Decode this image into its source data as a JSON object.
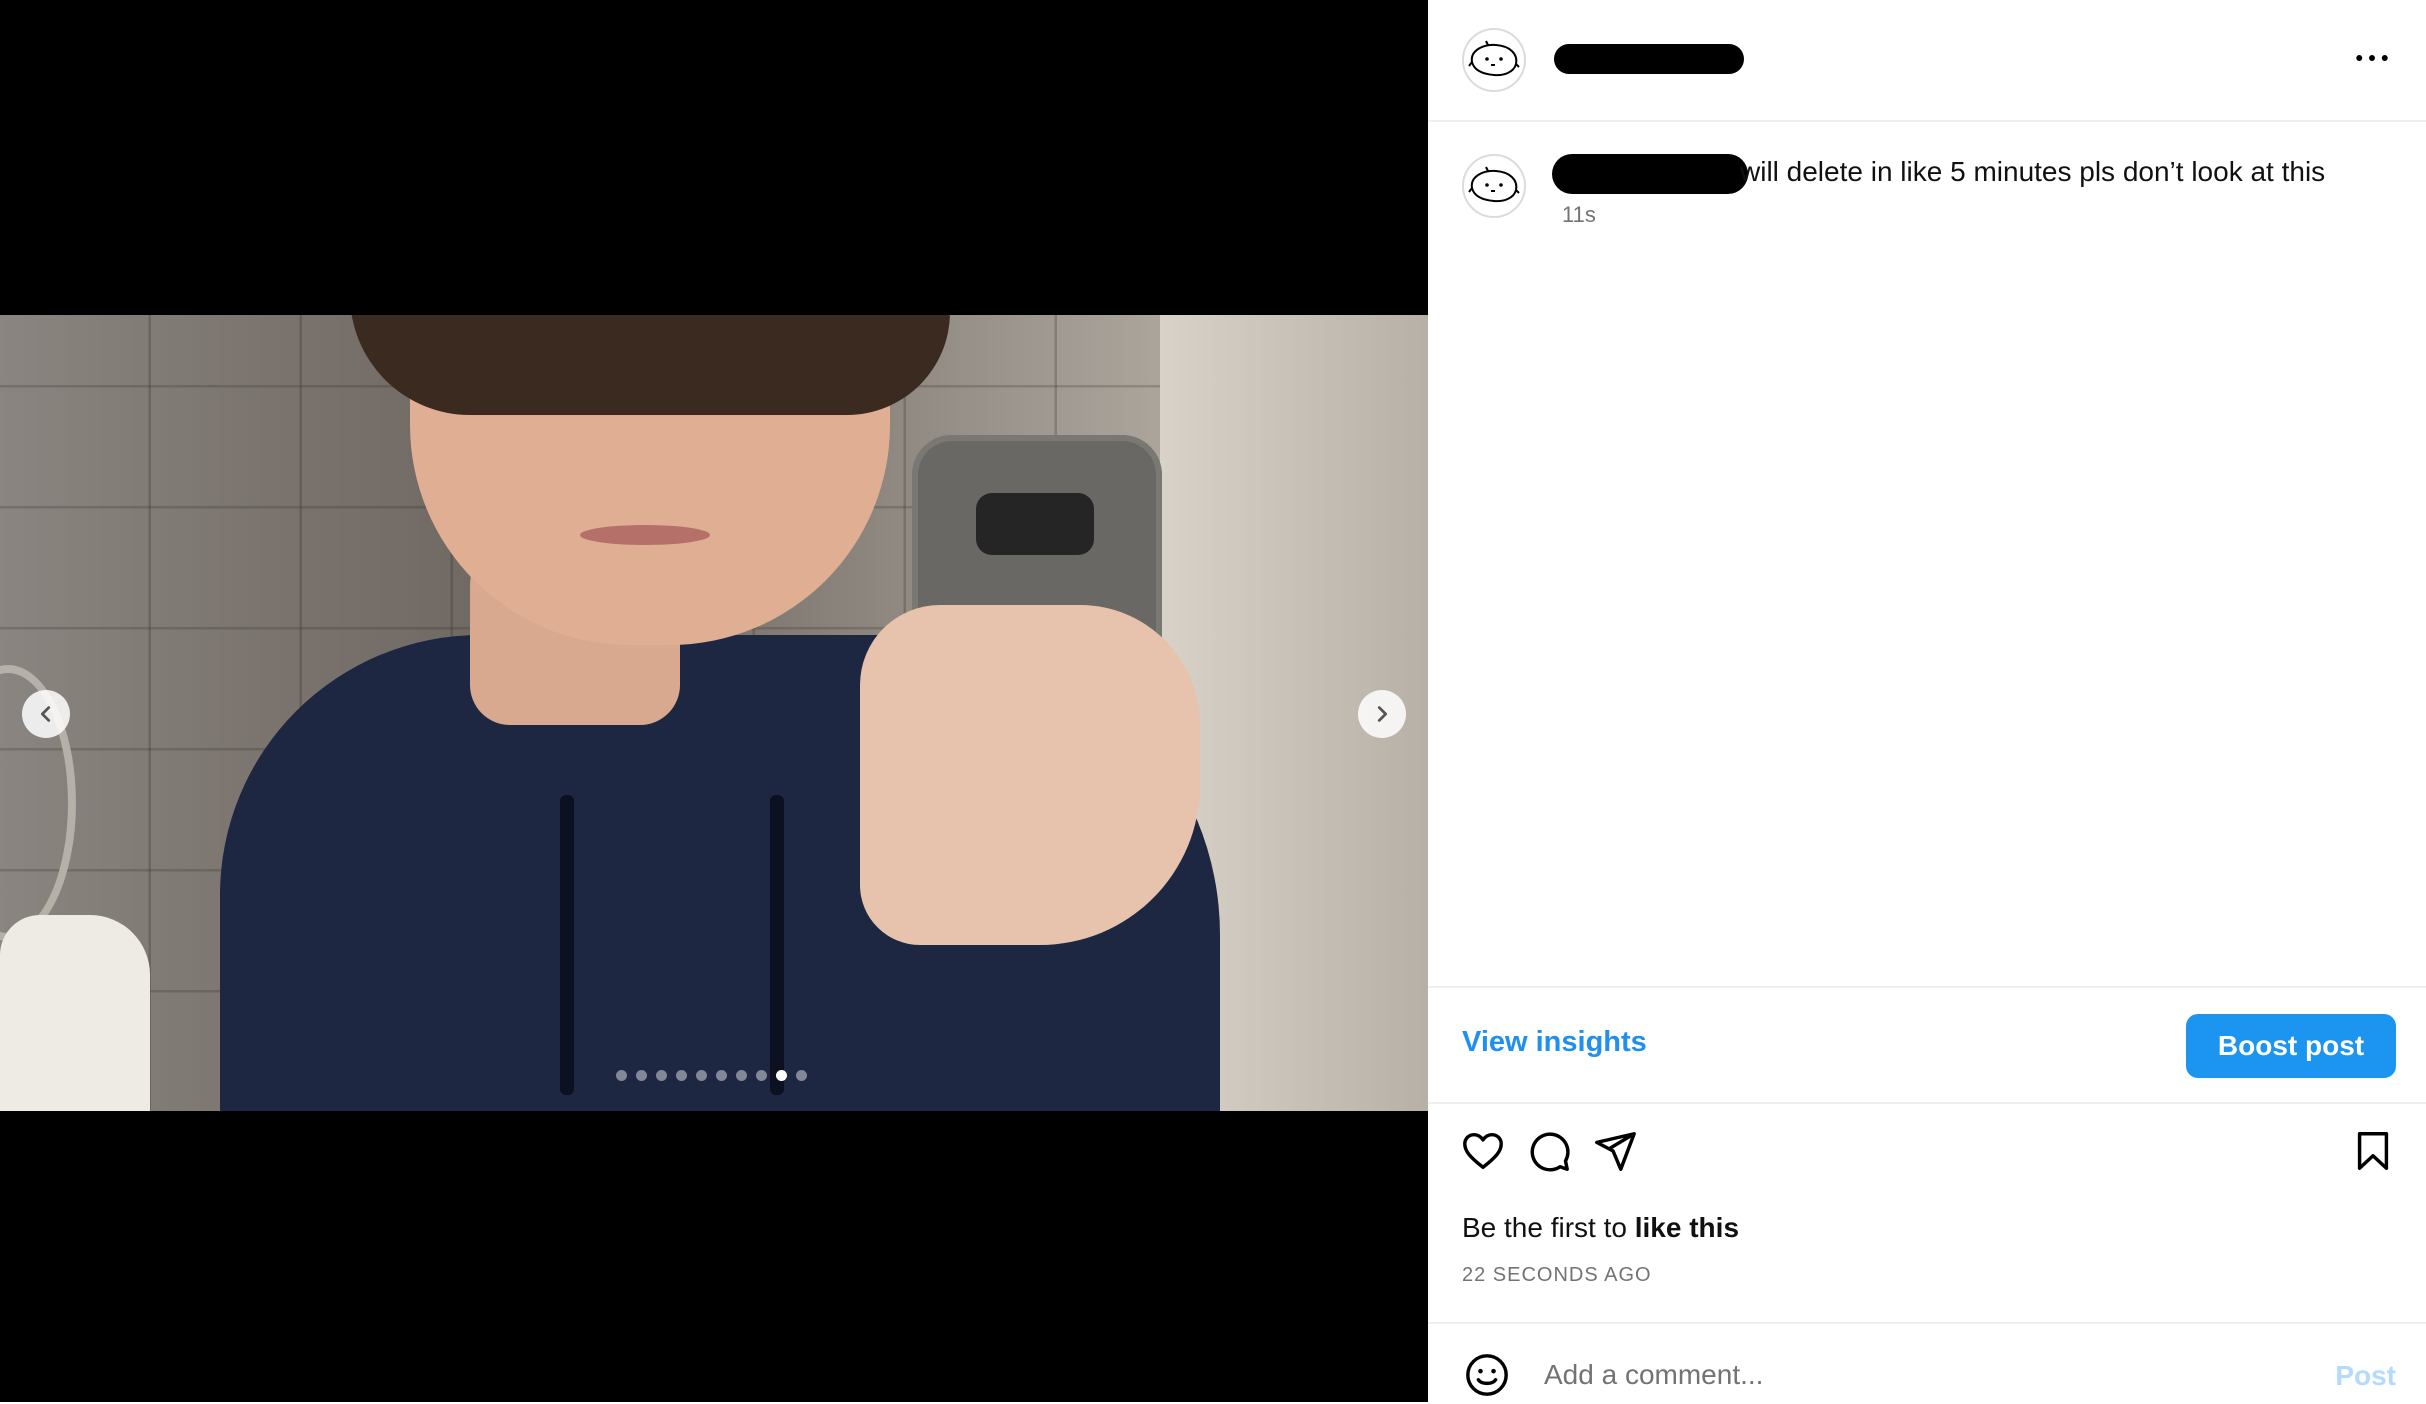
{
  "media": {
    "carousel_total": 10,
    "carousel_active_index": 8,
    "prev_icon": "chevron-left-icon",
    "next_icon": "chevron-right-icon"
  },
  "header": {
    "username_redacted": true,
    "more_icon": "more-horizontal-icon"
  },
  "caption": {
    "username_redacted": true,
    "text": "will delete in like 5 minutes pls don’t look at this",
    "time": "11s"
  },
  "insights": {
    "view_label": "View insights",
    "boost_label": "Boost post"
  },
  "actions": {
    "like_icon": "heart-icon",
    "comment_icon": "comment-icon",
    "share_icon": "send-icon",
    "save_icon": "bookmark-icon"
  },
  "likes": {
    "prefix": "Be the first to ",
    "bold": "like this"
  },
  "posted_ago": "22 SECONDS AGO",
  "comment": {
    "placeholder": "Add a comment...",
    "post_label": "Post",
    "emoji_icon": "smiley-icon"
  },
  "colors": {
    "accent": "#1c95f1",
    "link": "#1f8ff0",
    "post_disabled": "#b3dbff",
    "muted": "#737373"
  }
}
